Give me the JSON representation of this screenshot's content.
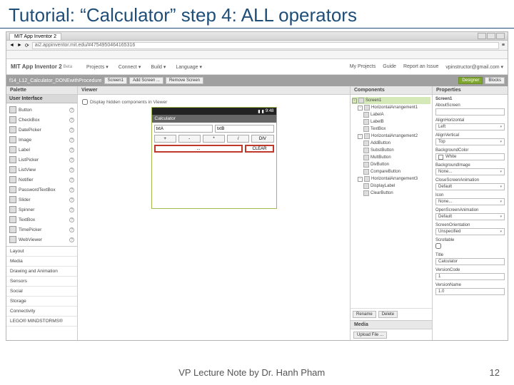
{
  "slide": {
    "title": "Tutorial: “Calculator” step 4: ALL operators"
  },
  "browser": {
    "tab": "MIT App Inventor 2",
    "url": "ai2.appinventor.mit.edu/#4754950464165316"
  },
  "header": {
    "logo": "MIT App Inventor 2",
    "beta": "Beta",
    "menus": [
      "Projects ▾",
      "Connect ▾",
      "Build ▾",
      "Language ▾"
    ],
    "right": [
      "My Projects",
      "Guide",
      "Report an Issue",
      "vpinstructor@gmail.com ▾"
    ]
  },
  "projbar": {
    "name": "f14_L12_Calculator_DONEwithProcedure",
    "screen_btn": "Screen1",
    "add": "Add Screen ...",
    "remove": "Remove Screen",
    "designer": "Designer",
    "blocks": "Blocks"
  },
  "palette": {
    "title": "Palette",
    "ui_section": "User Interface",
    "items": [
      "Button",
      "CheckBox",
      "DatePicker",
      "Image",
      "Label",
      "ListPicker",
      "ListView",
      "Notifier",
      "PasswordTextBox",
      "Slider",
      "Spinner",
      "TextBox",
      "TimePicker",
      "WebViewer"
    ],
    "categories": [
      "Layout",
      "Media",
      "Drawing and Animation",
      "Sensors",
      "Social",
      "Storage",
      "Connectivity",
      "LEGO® MINDSTORMS®"
    ]
  },
  "viewer": {
    "title": "Viewer",
    "hidden": "Display hidden components in Viewer",
    "time": "9:48",
    "phone_title": "Calculator",
    "fields": {
      "a": "txtA",
      "b": "txtB"
    },
    "ops": [
      "+",
      "-",
      "*",
      "/",
      "DIV"
    ],
    "result": "...",
    "clear": "CLEAR"
  },
  "components": {
    "title": "Components",
    "tree": [
      {
        "l": 0,
        "t": "-",
        "n": "Screen1",
        "sel": true
      },
      {
        "l": 1,
        "t": "-",
        "n": "HorizontalArrangement1"
      },
      {
        "l": 2,
        "n": "LabelA"
      },
      {
        "l": 2,
        "n": "LabelB"
      },
      {
        "l": 2,
        "n": "TextBox"
      },
      {
        "l": 1,
        "t": "-",
        "n": "HorizontalArrangement2"
      },
      {
        "l": 2,
        "n": "AddButton"
      },
      {
        "l": 2,
        "n": "SubstButton"
      },
      {
        "l": 2,
        "n": "MultButton"
      },
      {
        "l": 2,
        "n": "DivButton"
      },
      {
        "l": 2,
        "n": "CompareButton"
      },
      {
        "l": 1,
        "t": "-",
        "n": "HorizontalArrangement3"
      },
      {
        "l": 2,
        "n": "DisplayLabel"
      },
      {
        "l": 2,
        "n": "ClearButton"
      }
    ],
    "rename": "Rename",
    "delete": "Delete",
    "media_title": "Media",
    "upload": "Upload File ..."
  },
  "properties": {
    "title": "Properties",
    "subtitle": "Screen1",
    "items": [
      {
        "label": "AboutScreen",
        "val": "",
        "type": "text"
      },
      {
        "label": "AlignHorizontal",
        "val": "Left",
        "type": "dd"
      },
      {
        "label": "AlignVertical",
        "val": "Top",
        "type": "dd"
      },
      {
        "label": "BackgroundColor",
        "val": "White",
        "type": "color"
      },
      {
        "label": "BackgroundImage",
        "val": "None...",
        "type": "dd"
      },
      {
        "label": "CloseScreenAnimation",
        "val": "Default",
        "type": "dd"
      },
      {
        "label": "Icon",
        "val": "None...",
        "type": "dd"
      },
      {
        "label": "OpenScreenAnimation",
        "val": "Default",
        "type": "dd"
      },
      {
        "label": "ScreenOrientation",
        "val": "Unspecified",
        "type": "dd"
      },
      {
        "label": "Scrollable",
        "val": "",
        "type": "chk"
      },
      {
        "label": "Title",
        "val": "Calculator",
        "type": "text"
      },
      {
        "label": "VersionCode",
        "val": "1",
        "type": "text"
      },
      {
        "label": "VersionName",
        "val": "1.0",
        "type": "text"
      }
    ]
  },
  "footer": {
    "note": "VP Lecture Note by Dr. Hanh Pham",
    "page": "12"
  }
}
